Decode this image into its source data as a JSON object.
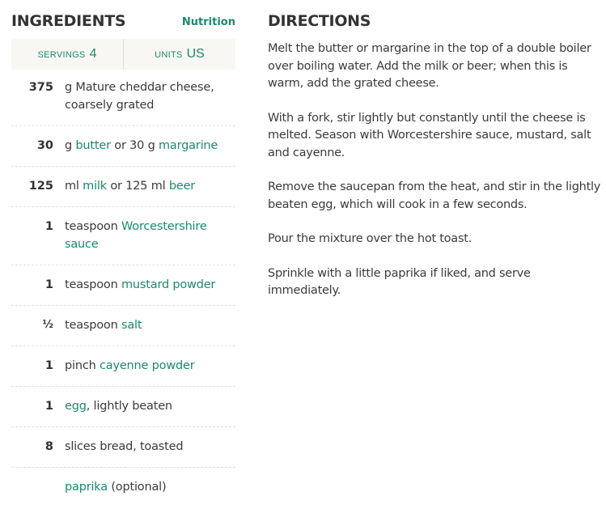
{
  "ingredients_section": {
    "title": "INGREDIENTS",
    "nutrition_link": "Nutrition",
    "servings": {
      "label": "Servings",
      "value": "4"
    },
    "units": {
      "label": "Units",
      "value": "US"
    },
    "items": [
      {
        "qty": "375",
        "parts": [
          {
            "text": "g Mature cheddar cheese, coarsely grated",
            "link": false
          }
        ]
      },
      {
        "qty": "30",
        "parts": [
          {
            "text": "g ",
            "link": false
          },
          {
            "text": "butter",
            "link": true
          },
          {
            "text": " or 30 g ",
            "link": false
          },
          {
            "text": "margarine",
            "link": true
          }
        ]
      },
      {
        "qty": "125",
        "parts": [
          {
            "text": "ml ",
            "link": false
          },
          {
            "text": "milk",
            "link": true
          },
          {
            "text": " or 125 ml ",
            "link": false
          },
          {
            "text": "beer",
            "link": true
          }
        ]
      },
      {
        "qty": "1",
        "parts": [
          {
            "text": "teaspoon ",
            "link": false
          },
          {
            "text": "Worcestershire sauce",
            "link": true
          }
        ]
      },
      {
        "qty": "1",
        "parts": [
          {
            "text": "teaspoon ",
            "link": false
          },
          {
            "text": "mustard powder",
            "link": true
          }
        ]
      },
      {
        "qty": "½",
        "parts": [
          {
            "text": "teaspoon ",
            "link": false
          },
          {
            "text": "salt",
            "link": true
          }
        ]
      },
      {
        "qty": "1",
        "parts": [
          {
            "text": "pinch ",
            "link": false
          },
          {
            "text": "cayenne powder",
            "link": true
          }
        ]
      },
      {
        "qty": "1",
        "parts": [
          {
            "text": "egg",
            "link": true
          },
          {
            "text": ", lightly beaten",
            "link": false
          }
        ]
      },
      {
        "qty": "8",
        "parts": [
          {
            "text": "slices bread, toasted",
            "link": false
          }
        ]
      },
      {
        "qty": "",
        "parts": [
          {
            "text": "paprika",
            "link": true
          },
          {
            "text": " (optional)",
            "link": false
          }
        ]
      }
    ]
  },
  "directions_section": {
    "title": "DIRECTIONS",
    "steps": [
      "Melt the butter or margarine in the top of a double boiler over boiling water. Add the milk or beer; when this is warm, add the grated cheese.",
      "With a fork, stir lightly but constantly until the cheese is melted. Season with Worcestershire sauce, mustard, salt and cayenne.",
      "Remove the saucepan from the heat, and stir in the lightly beaten egg, which will cook in a few seconds.",
      "Pour the mixture over the hot toast.",
      "Sprinkle with a little paprika if liked, and serve immediately."
    ]
  },
  "colors": {
    "accent": "#1a8a6e",
    "text": "#3b3b3b",
    "settings_bg": "#f8f7f3"
  }
}
